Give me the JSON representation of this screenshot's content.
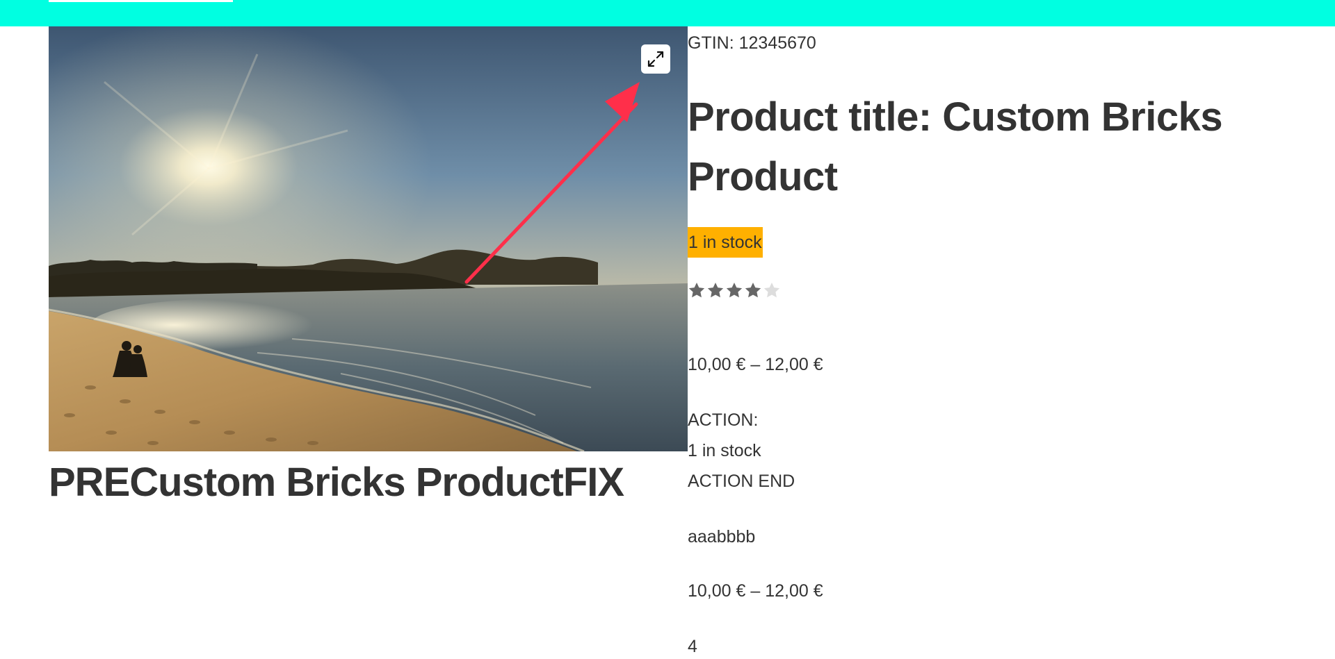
{
  "gallery": {
    "zoom_icon": "expand-arrows-icon",
    "annotation": "red arrow pointing to zoom button"
  },
  "left_heading": "PRECustom Bricks ProductFIX",
  "summary": {
    "gtin": "GTIN: 12345670",
    "title": "Product title: Custom Bricks Product",
    "stock_badge": "1 in stock",
    "stock_badge_color": "#ffb000",
    "rating": {
      "value": 4,
      "max": 5,
      "filled_color": "#666666",
      "empty_color": "#dddddd"
    },
    "price_range": "10,00 € – 12,00 €",
    "action_start": "ACTION:",
    "action_stock": "1 in stock",
    "action_end": "ACTION END",
    "custom_text": "aaabbbb",
    "price_range_2": "10,00 € – 12,00 €",
    "rating_number": "4"
  },
  "colors": {
    "top_bar": "#00ffe1",
    "arrow": "#ff2f4a"
  }
}
